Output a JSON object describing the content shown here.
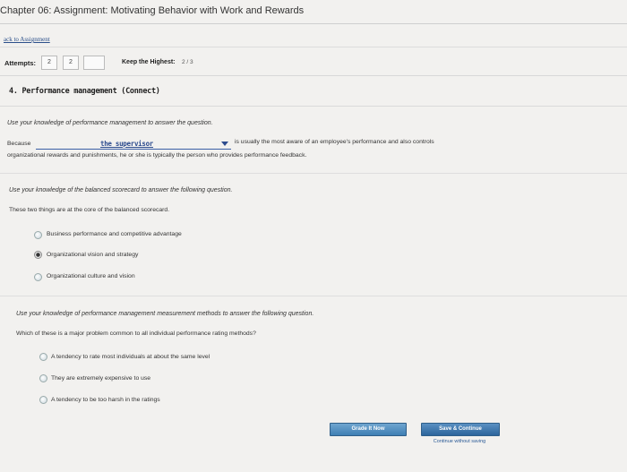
{
  "header": {
    "title": "Chapter 06: Assignment: Motivating Behavior with Work and Rewards",
    "back_link": "ack to Assignment"
  },
  "attempts": {
    "label": "Attempts:",
    "boxes": [
      "2",
      "2",
      ""
    ],
    "keep_label": "Keep the Highest:",
    "keep_value": "2 / 3"
  },
  "question": {
    "heading": "4. Performance management (Connect)",
    "section1": {
      "instruction": "Use your knowledge of performance management to answer the question.",
      "before_blank": "Because",
      "dropdown_value": "the supervisor",
      "after_blank": "is usually the most aware of an employee's performance and also controls",
      "line2": "organizational rewards and punishments, he or she is typically the person who provides performance feedback."
    },
    "section2": {
      "instruction": "Use your knowledge of the balanced scorecard to answer the following question.",
      "prompt": "These two things are at the core of the balanced scorecard.",
      "options": [
        {
          "label": "Business performance and competitive advantage",
          "selected": false
        },
        {
          "label": "Organizational vision and strategy",
          "selected": true
        },
        {
          "label": "Organizational culture and vision",
          "selected": false
        }
      ]
    },
    "section3": {
      "instruction": "Use your knowledge of performance management measurement methods to answer the following question.",
      "prompt": "Which of these is a major problem common to all individual performance rating methods?",
      "options": [
        {
          "label": "A tendency to rate most individuals at about the same level",
          "selected": false
        },
        {
          "label": "They are extremely expensive to use",
          "selected": false
        },
        {
          "label": "A tendency to be too harsh in the ratings",
          "selected": false
        }
      ]
    }
  },
  "footer": {
    "grade_button": "Grade It Now",
    "save_button": "Save & Continue",
    "continue_link": "Continue without saving"
  }
}
